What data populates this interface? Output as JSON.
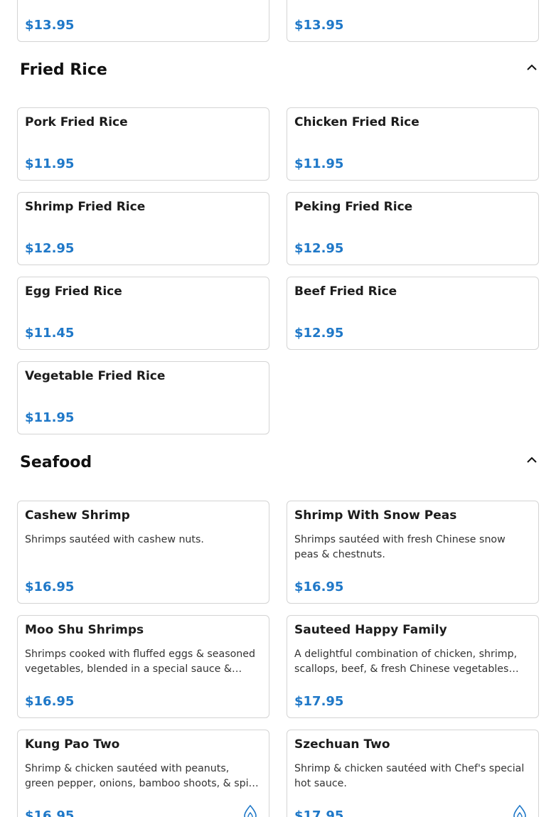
{
  "top_cards": [
    {
      "price": "$13.95"
    },
    {
      "price": "$13.95"
    }
  ],
  "sections": {
    "fried_rice": {
      "title": "Fried Rice",
      "items": [
        {
          "name": "Pork Fried Rice",
          "price": "$11.95"
        },
        {
          "name": "Chicken Fried Rice",
          "price": "$11.95"
        },
        {
          "name": "Shrimp Fried Rice",
          "price": "$12.95"
        },
        {
          "name": "Peking Fried Rice",
          "price": "$12.95"
        },
        {
          "name": "Egg Fried Rice",
          "price": "$11.45"
        },
        {
          "name": "Beef Fried Rice",
          "price": "$12.95"
        },
        {
          "name": "Vegetable Fried Rice",
          "price": "$11.95"
        }
      ]
    },
    "seafood": {
      "title": "Seafood",
      "items": [
        {
          "name": "Cashew Shrimp",
          "desc": "Shrimps sautéed with cashew nuts.",
          "price": "$16.95"
        },
        {
          "name": "Shrimp With Snow Peas",
          "desc": "Shrimps sautéed with fresh Chinese snow peas & chestnuts.",
          "price": "$16.95"
        },
        {
          "name": "Moo Shu Shrimps",
          "desc": "Shrimps cooked with fluffed eggs & seasoned vegetables, blended in a special sauce & served with pancakes.",
          "price": "$16.95"
        },
        {
          "name": "Sauteed Happy Family",
          "desc": "A delightful combination of chicken, shrimp, scallops, beef, & fresh Chinese vegetables sautéed in a brown sauce.",
          "price": "$17.95"
        },
        {
          "name": "Kung Pao Two",
          "desc": "Shrimp & chicken sautéed with peanuts, green pepper, onions, bamboo shoots, & spicy hot sauce.",
          "price": "$16.95",
          "icon": "spicy-icon"
        },
        {
          "name": "Szechuan Two",
          "desc": "Shrimp & chicken sautéed with Chef's special hot sauce.",
          "price": "$17.95",
          "icon": "spicy-icon"
        }
      ]
    }
  },
  "icons": {
    "collapse": "chevron-up-icon",
    "spicy": "spicy-icon"
  },
  "colors": {
    "price": "#1f78c8",
    "border": "#d4d4d4",
    "spicy": "#1f78c8"
  }
}
